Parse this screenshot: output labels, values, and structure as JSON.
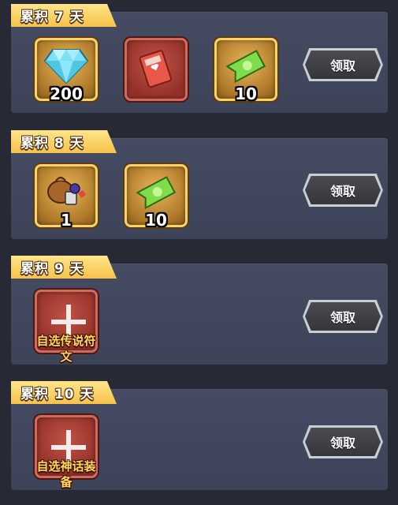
{
  "rewards": [
    {
      "title": "累积 7 天",
      "claim_label": "领取",
      "items": [
        {
          "icon": "diamond-icon",
          "frame": "gold",
          "qty": "200"
        },
        {
          "icon": "red-ticket-icon",
          "frame": "red",
          "qty": ""
        },
        {
          "icon": "green-ticket-icon",
          "frame": "gold",
          "qty": "10"
        }
      ]
    },
    {
      "title": "累积 8 天",
      "claim_label": "领取",
      "items": [
        {
          "icon": "treasure-bag-icon",
          "frame": "gold",
          "qty": "1"
        },
        {
          "icon": "green-ticket-icon",
          "frame": "gold",
          "qty": "10"
        }
      ]
    },
    {
      "title": "累积 9 天",
      "claim_label": "领取",
      "items": [
        {
          "icon": "plus-icon",
          "frame": "red",
          "label": "自选传说符文"
        }
      ]
    },
    {
      "title": "累积 10 天",
      "claim_label": "领取",
      "items": [
        {
          "icon": "plus-icon",
          "frame": "red",
          "label": "自选神话装备"
        }
      ]
    }
  ]
}
